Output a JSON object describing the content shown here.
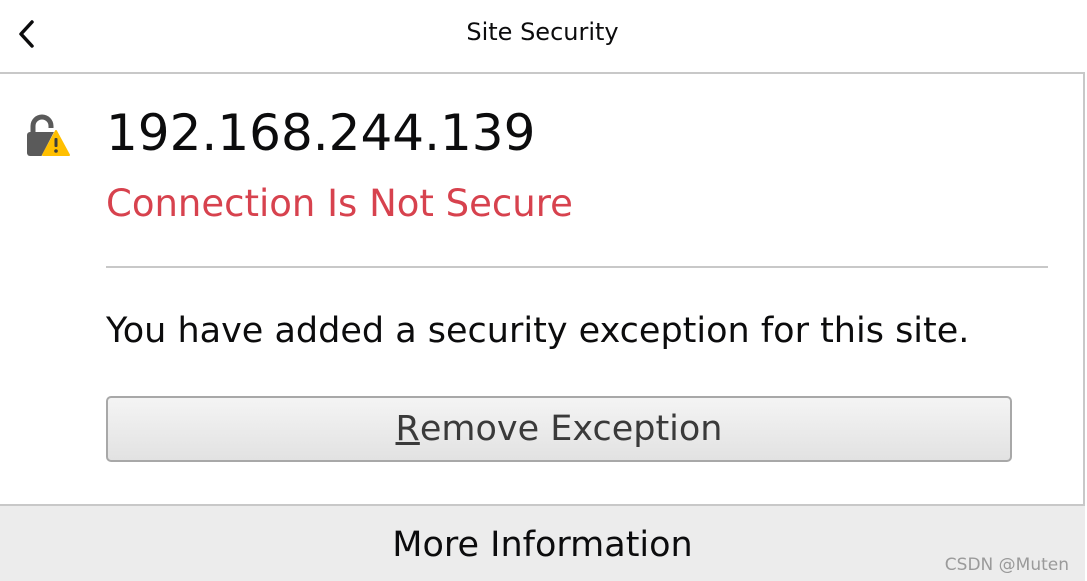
{
  "header": {
    "back_icon": "chevron-left-icon",
    "title": "Site Security"
  },
  "site": {
    "lock_icon": "lock-warning-icon",
    "host": "192.168.244.139",
    "status": "Connection Is Not Secure",
    "status_color": "#d7424e"
  },
  "exception": {
    "message": "You have added a security exception for this site.",
    "button_accesskey_label": "R",
    "button_rest_label": "emove Exception"
  },
  "footer": {
    "more_info_label": "More Information"
  },
  "watermark": "CSDN @Muten"
}
